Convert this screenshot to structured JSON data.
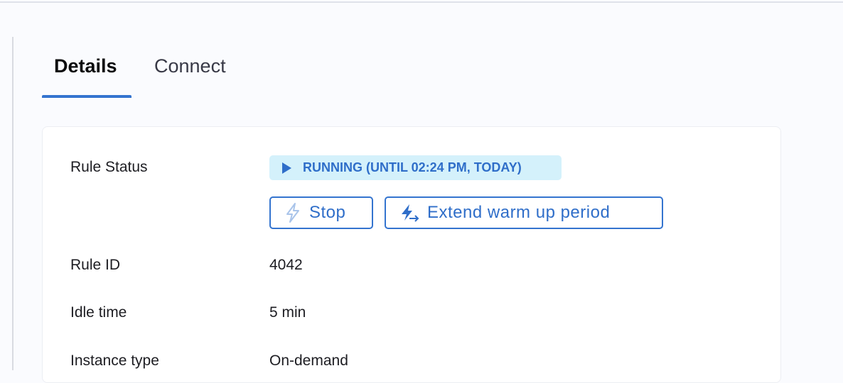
{
  "tabs": [
    {
      "label": "Details"
    },
    {
      "label": "Connect"
    }
  ],
  "details": {
    "rule_status_label": "Rule Status",
    "status_badge": "RUNNING (UNTIL 02:24 PM, TODAY)",
    "stop_label": "Stop",
    "extend_label": "Extend warm up period",
    "rows": [
      {
        "label": "Rule ID",
        "value": "4042"
      },
      {
        "label": "Idle time",
        "value": "5 min"
      },
      {
        "label": "Instance type",
        "value": "On-demand"
      }
    ]
  }
}
